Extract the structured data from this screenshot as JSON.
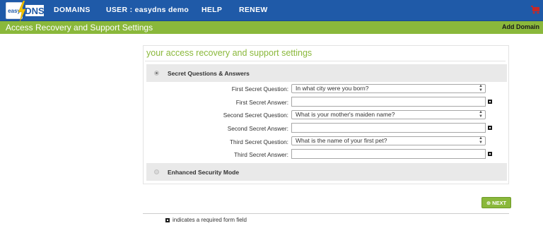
{
  "brand": {
    "logo_easy": "easy",
    "logo_dns": "DNS"
  },
  "topnav": {
    "domains": "DOMAINS",
    "user": "USER : easydns demo",
    "help": "HELP",
    "renew": "RENEW",
    "cart_icon": "shopping-cart-icon"
  },
  "page": {
    "title": "Access Recovery and Support Settings",
    "add_domain": "Add Domain"
  },
  "panel": {
    "title": "your access recovery and support settings",
    "section_questions": "Secret Questions & Answers",
    "section_enhanced": "Enhanced Security Mode",
    "rows": {
      "q1_label": "First Secret Question:",
      "q1_value": "In what city were you born?",
      "a1_label": "First Secret Answer:",
      "a1_value": "",
      "q2_label": "Second Secret Question:",
      "q2_value": "What is your mother's maiden name?",
      "a2_label": "Second Secret Answer:",
      "a2_value": "",
      "q3_label": "Third Secret Question:",
      "q3_value": "What is the name of your first pet?",
      "a3_label": "Third Secret Answer:",
      "a3_value": ""
    }
  },
  "next_label": "NEXT",
  "footer_note": "indicates a required form field",
  "colors": {
    "nav_blue": "#1f5aa8",
    "accent_green": "#8ab83b"
  }
}
